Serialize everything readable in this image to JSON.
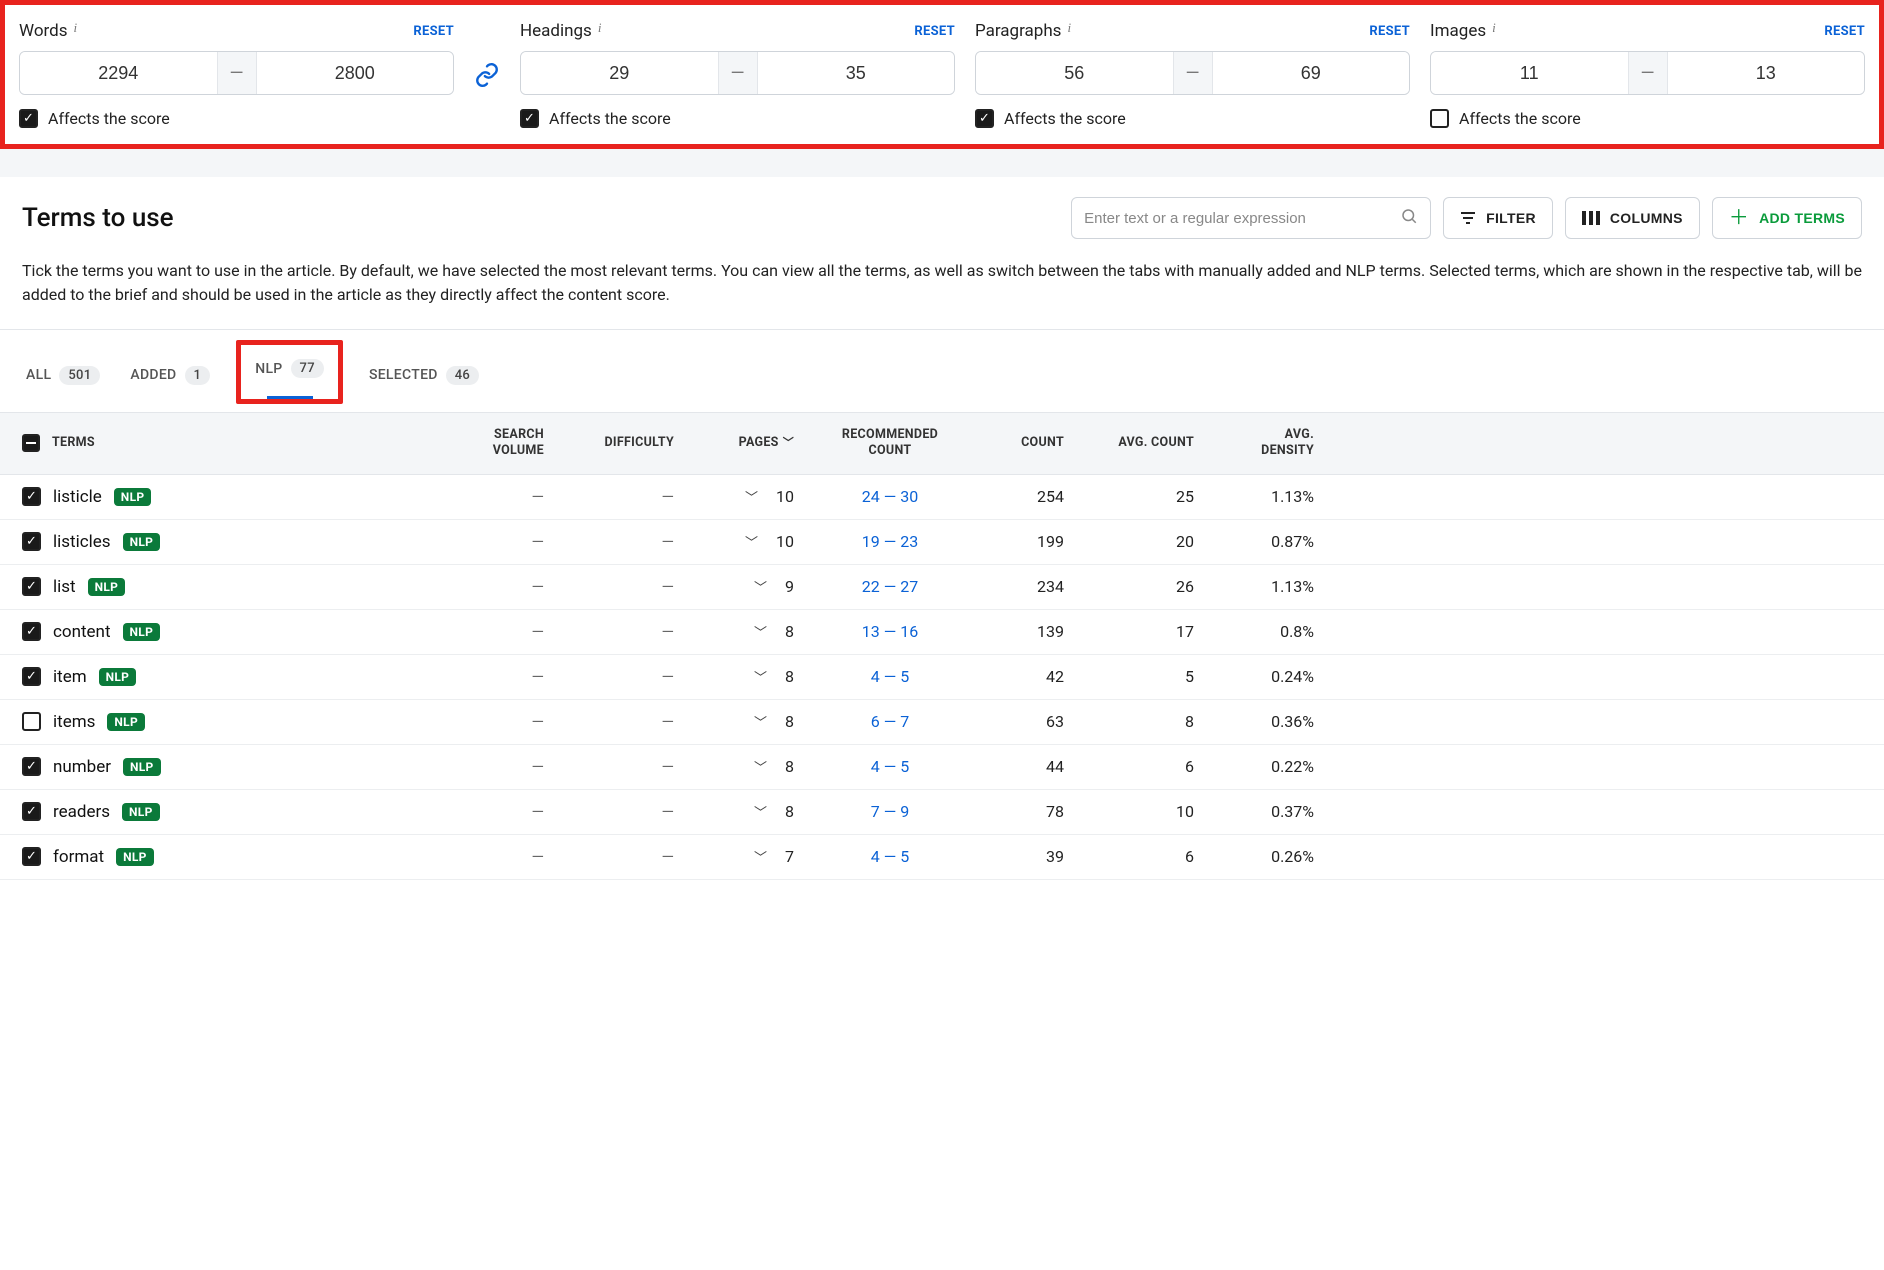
{
  "structure": [
    {
      "label": "Words",
      "reset": "RESET",
      "min": "2294",
      "max": "2800",
      "affects_label": "Affects the score",
      "affects": true
    },
    {
      "label": "Headings",
      "reset": "RESET",
      "min": "29",
      "max": "35",
      "affects_label": "Affects the score",
      "affects": true
    },
    {
      "label": "Paragraphs",
      "reset": "RESET",
      "min": "56",
      "max": "69",
      "affects_label": "Affects the score",
      "affects": true
    },
    {
      "label": "Images",
      "reset": "RESET",
      "min": "11",
      "max": "13",
      "affects_label": "Affects the score",
      "affects": false
    }
  ],
  "terms_header": {
    "title": "Terms to use",
    "search_placeholder": "Enter text or a regular expression",
    "filter": "FILTER",
    "columns": "COLUMNS",
    "add_terms": "ADD TERMS"
  },
  "description": "Tick the terms you want to use in the article. By default, we have selected the most relevant terms. You can view all the terms, as well as switch between the tabs with manually added and NLP terms. Selected terms, which are shown in the respective tab, will be added to the brief and should be used in the article as they directly affect the content score.",
  "tabs": [
    {
      "label": "ALL",
      "count": "501"
    },
    {
      "label": "ADDED",
      "count": "1"
    },
    {
      "label": "NLP",
      "count": "77"
    },
    {
      "label": "SELECTED",
      "count": "46"
    }
  ],
  "columns": {
    "terms": "TERMS",
    "search_volume_1": "SEARCH",
    "search_volume_2": "VOLUME",
    "difficulty": "DIFFICULTY",
    "pages": "PAGES",
    "recommended_1": "RECOMMENDED",
    "recommended_2": "COUNT",
    "count": "COUNT",
    "avg_count": "AVG. COUNT",
    "avg_density_1": "AVG.",
    "avg_density_2": "DENSITY"
  },
  "nlp_badge": "NLP",
  "rows": [
    {
      "checked": true,
      "term": "listicle",
      "sv": "—",
      "diff": "—",
      "pages": "10",
      "rec": "24 — 30",
      "count": "254",
      "avg_count": "25",
      "avg_density": "1.13%"
    },
    {
      "checked": true,
      "term": "listicles",
      "sv": "—",
      "diff": "—",
      "pages": "10",
      "rec": "19 — 23",
      "count": "199",
      "avg_count": "20",
      "avg_density": "0.87%"
    },
    {
      "checked": true,
      "term": "list",
      "sv": "—",
      "diff": "—",
      "pages": "9",
      "rec": "22 — 27",
      "count": "234",
      "avg_count": "26",
      "avg_density": "1.13%"
    },
    {
      "checked": true,
      "term": "content",
      "sv": "—",
      "diff": "—",
      "pages": "8",
      "rec": "13 — 16",
      "count": "139",
      "avg_count": "17",
      "avg_density": "0.8%"
    },
    {
      "checked": true,
      "term": "item",
      "sv": "—",
      "diff": "—",
      "pages": "8",
      "rec": "4 — 5",
      "count": "42",
      "avg_count": "5",
      "avg_density": "0.24%"
    },
    {
      "checked": false,
      "term": "items",
      "sv": "—",
      "diff": "—",
      "pages": "8",
      "rec": "6 — 7",
      "count": "63",
      "avg_count": "8",
      "avg_density": "0.36%"
    },
    {
      "checked": true,
      "term": "number",
      "sv": "—",
      "diff": "—",
      "pages": "8",
      "rec": "4 — 5",
      "count": "44",
      "avg_count": "6",
      "avg_density": "0.22%"
    },
    {
      "checked": true,
      "term": "readers",
      "sv": "—",
      "diff": "—",
      "pages": "8",
      "rec": "7 — 9",
      "count": "78",
      "avg_count": "10",
      "avg_density": "0.37%"
    },
    {
      "checked": true,
      "term": "format",
      "sv": "—",
      "diff": "—",
      "pages": "7",
      "rec": "4 — 5",
      "count": "39",
      "avg_count": "6",
      "avg_density": "0.26%"
    }
  ]
}
